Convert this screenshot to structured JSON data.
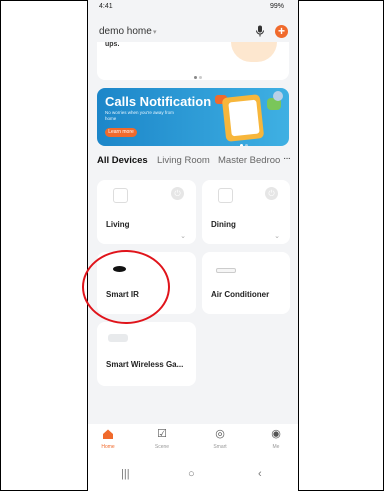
{
  "status": {
    "time": "4:41",
    "right": "99%"
  },
  "header": {
    "home_name": "demo home",
    "caret": "▾",
    "add": "+"
  },
  "top_card": {
    "snippet": "ups."
  },
  "banner": {
    "title": "Calls Notification",
    "subtitle": "No worries when you're away from home",
    "button": "Learn more"
  },
  "tabs": {
    "items": [
      "All Devices",
      "Living Room",
      "Master Bedroo"
    ],
    "more": "···"
  },
  "devices": [
    {
      "name": "Living",
      "icon": "wall-switch-icon"
    },
    {
      "name": "Dining",
      "icon": "wall-switch-icon"
    },
    {
      "name": "Smart IR",
      "icon": "ir-blaster-icon"
    },
    {
      "name": "Air Conditioner",
      "icon": "air-conditioner-icon"
    },
    {
      "name": "Smart Wireless Ga...",
      "icon": "gateway-icon"
    }
  ],
  "navbar": {
    "home": "Home",
    "scene": "Scene",
    "smart": "Smart",
    "me": "Me"
  },
  "system_nav": {
    "recents": "|||",
    "home": "○",
    "back": "‹"
  },
  "colors": {
    "accent": "#f06a2c",
    "annotation": "#e0141b",
    "banner": "#1c86c9"
  }
}
